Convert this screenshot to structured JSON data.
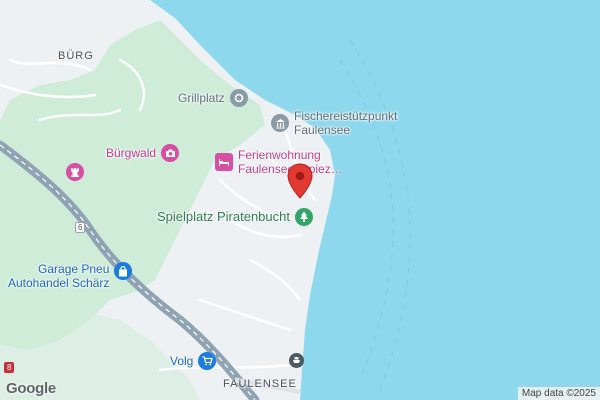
{
  "map": {
    "colors": {
      "water": "#8ed8ee",
      "land": "#eef1f4",
      "park": "#cfecd9",
      "road": "#ffffff",
      "highway": "#8fa3b3",
      "route_dash": "#ffffff",
      "pin": "#e23a32"
    },
    "area_labels": {
      "burg": "BÜRG",
      "faulensee": "FAULENSEE"
    },
    "route_shields": {
      "route_6": "6",
      "route_8": "8"
    },
    "pois": {
      "grillplatz": {
        "label": "Grillplatz",
        "icon": "pin-circle-icon"
      },
      "fischerei": {
        "line1": "Fischereistützpunkt",
        "line2": "Faulensee",
        "icon": "museum-icon"
      },
      "buergwald": {
        "label": "Bürgwald",
        "icon": "camera-icon"
      },
      "ferienwohnung": {
        "line1": "Ferienwohnung",
        "line2": "Faulensee, Spiez…",
        "icon": "bed-icon"
      },
      "castle": {
        "icon": "chess-rook-icon"
      },
      "spielplatz": {
        "label": "Spielplatz Piratenbucht",
        "icon": "tree-icon"
      },
      "garage": {
        "line1": "Garage Pneu",
        "line2": "Autohandel Schärz",
        "icon": "shopping-bag-icon"
      },
      "volg": {
        "label": "Volg",
        "icon": "cart-icon"
      },
      "ferry": {
        "icon": "ferry-icon"
      }
    },
    "marker": {
      "icon": "map-pin-icon"
    },
    "google_logo": "Google",
    "attribution": "Map data ©2025"
  }
}
